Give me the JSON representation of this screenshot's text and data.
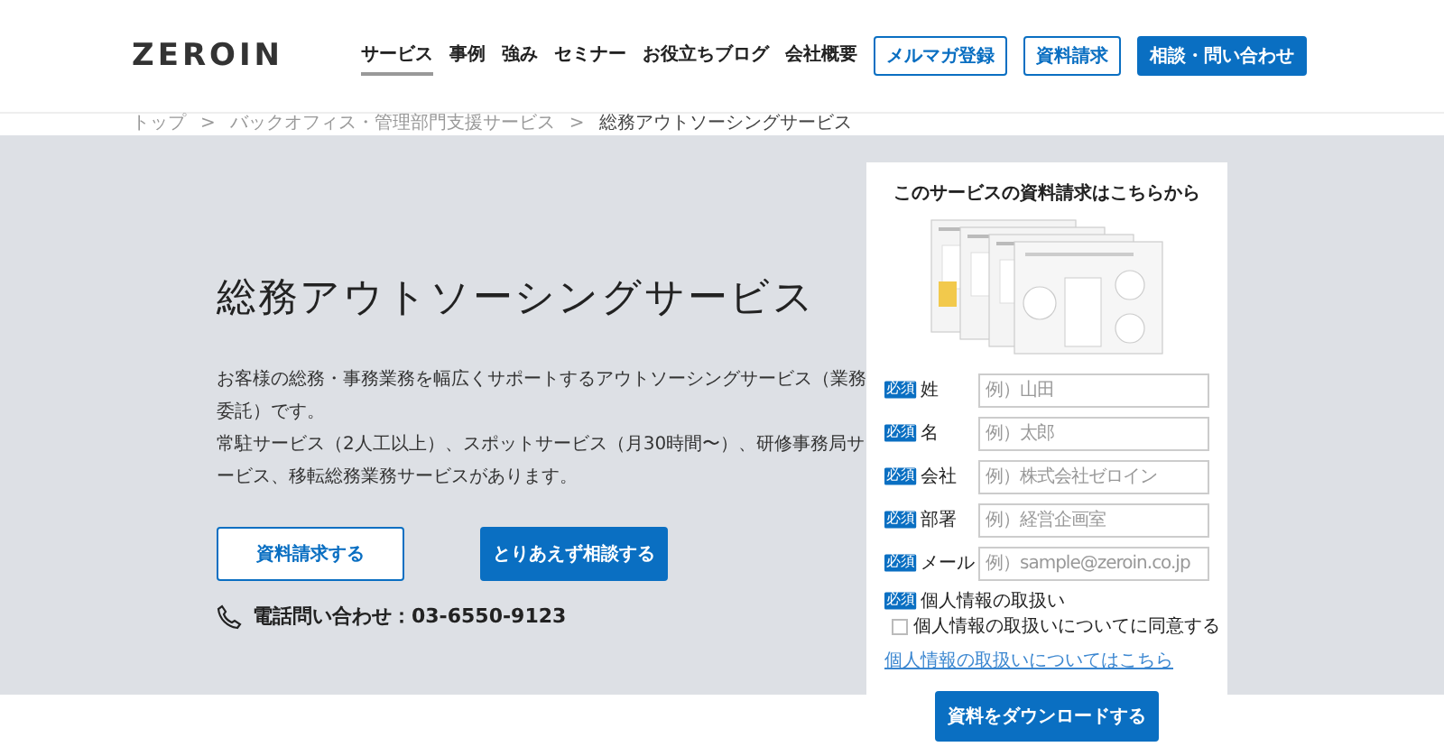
{
  "header": {
    "logo": "ZEROIN",
    "nav": [
      {
        "label": "サービス",
        "selected": true
      },
      {
        "label": "事例",
        "selected": false
      },
      {
        "label": "強み",
        "selected": false
      },
      {
        "label": "セミナー",
        "selected": false
      },
      {
        "label": "お役立ちブログ",
        "selected": false
      },
      {
        "label": "会社概要",
        "selected": false
      }
    ],
    "buttons": [
      {
        "label": "メルマガ登録",
        "kind": "outline"
      },
      {
        "label": "資料請求",
        "kind": "outline"
      },
      {
        "label": "相談・問い合わせ",
        "kind": "filled"
      }
    ]
  },
  "breadcrumb": [
    {
      "label": "トップ",
      "current": false
    },
    {
      "label": "バックオフィス・管理部門支援サービス",
      "current": false
    },
    {
      "label": "総務アウトソーシングサービス",
      "current": true
    }
  ],
  "breadcrumb_separator": ">",
  "hero": {
    "title": "総務アウトソーシングサービス",
    "paragraphs": [
      "お客様の総務・事務業務を幅広くサポートするアウトソーシングサービス（業務委託）です。",
      "常駐サービス（2人工以上）、スポットサービス（月30時間〜）、研修事務局サービス、移転総務業務サービスがあります。"
    ],
    "buttons": [
      {
        "label": "資料請求する",
        "kind": "outline"
      },
      {
        "label": "とりあえず相談する",
        "kind": "filled"
      }
    ],
    "phone": "電話問い合わせ：03-6550-9123"
  },
  "form": {
    "title": "このサービスの資料請求はこちらから",
    "fields": [
      {
        "badge": "必須",
        "label": "姓",
        "placeholder": "例）山田"
      },
      {
        "badge": "必須",
        "label": "名",
        "placeholder": "例）太郎"
      },
      {
        "badge": "必須",
        "label": "会社",
        "placeholder": "例）株式会社ゼロイン"
      },
      {
        "badge": "必須",
        "label": "部署",
        "placeholder": "例）経営企画室"
      },
      {
        "badge": "必須",
        "label": "メール",
        "placeholder": "例）sample@zeroin.co.jp"
      }
    ],
    "privacy": {
      "badge": "必須",
      "label": "個人情報の取扱い",
      "consent": "個人情報の取扱いについてに同意する",
      "checked": false,
      "link": "個人情報の取扱いについてはこちら"
    },
    "submit": "資料をダウンロードする"
  }
}
